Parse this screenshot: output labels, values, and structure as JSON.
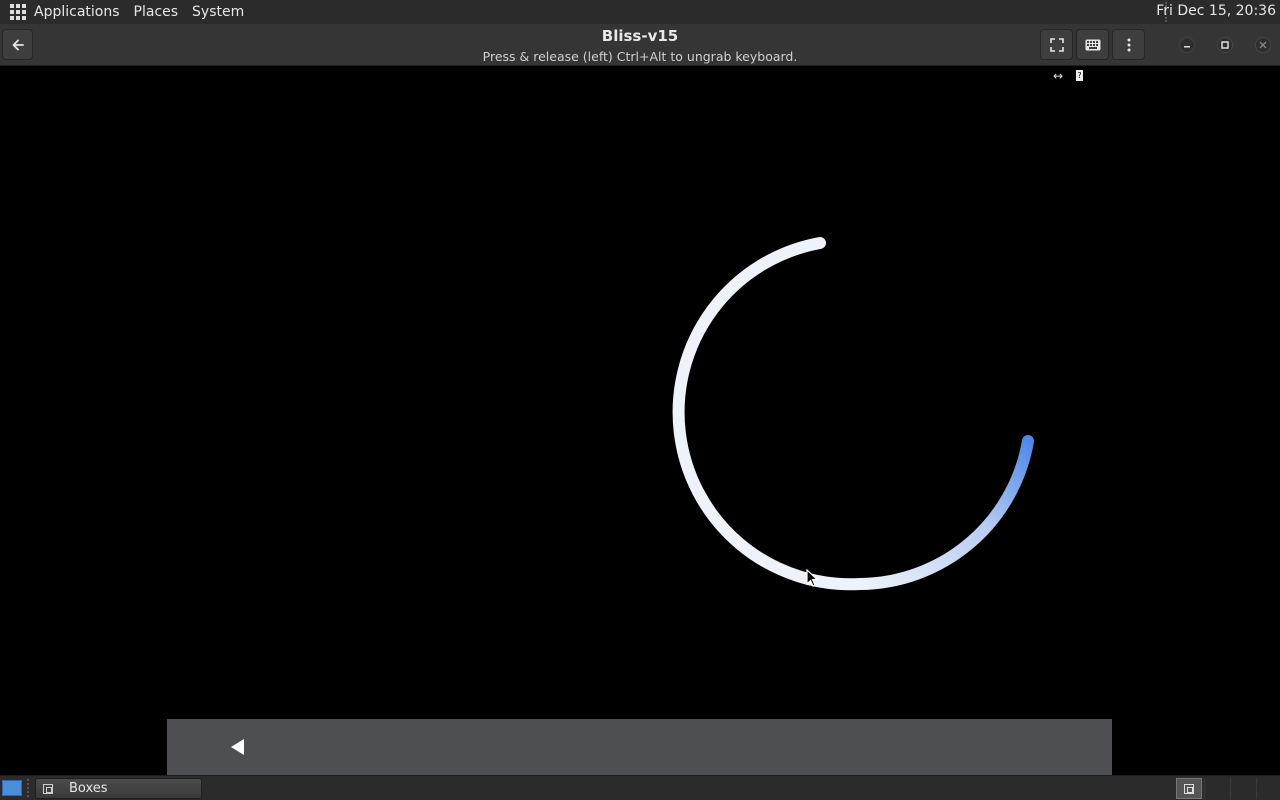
{
  "top_panel": {
    "applications_label": "Applications",
    "places_label": "Places",
    "system_label": "System",
    "clock": "Fri Dec 15, 20:36"
  },
  "window": {
    "title": "Bliss-v15",
    "subtitle": "Press & release (left) Ctrl+Alt to ungrab keyboard.",
    "resize_hint": "↔"
  },
  "icons": {
    "back": "arrow-left-icon",
    "fullscreen": "fullscreen-icon",
    "keyboard": "keyboard-icon",
    "menu": "vertical-dots-icon",
    "minimize": "minimize-icon",
    "maximize": "maximize-icon",
    "close": "close-icon"
  },
  "vm": {
    "spinner_color_primary": "#eef2fa",
    "spinner_color_accent": "#4f8ae8",
    "bottom_bar_color": "#4d4f52"
  },
  "taskbar": {
    "boxes_label": "Boxes"
  }
}
